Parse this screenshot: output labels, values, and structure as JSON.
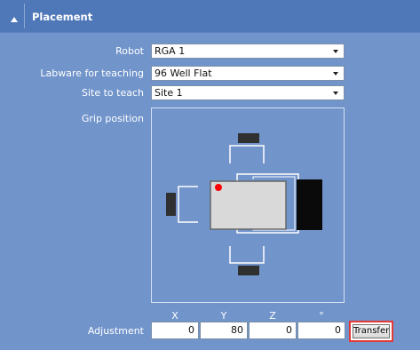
{
  "section": {
    "title": "Placement"
  },
  "form": {
    "robot": {
      "label": "Robot",
      "value": "RGA 1"
    },
    "labware": {
      "label": "Labware for teaching",
      "value": "96 Well Flat"
    },
    "site": {
      "label": "Site to teach",
      "value": "Site 1"
    },
    "grip": {
      "label": "Grip position"
    }
  },
  "adjustment": {
    "label": "Adjustment",
    "axes": [
      "X",
      "Y",
      "Z",
      "°"
    ],
    "values": [
      "0",
      "80",
      "0",
      "0"
    ],
    "transfer_label": "Transfer"
  },
  "colors": {
    "panel_bg": "#7194cb",
    "header_bg": "#4f78b8",
    "highlight_border": "#e53935",
    "marker": "#ff0000"
  }
}
